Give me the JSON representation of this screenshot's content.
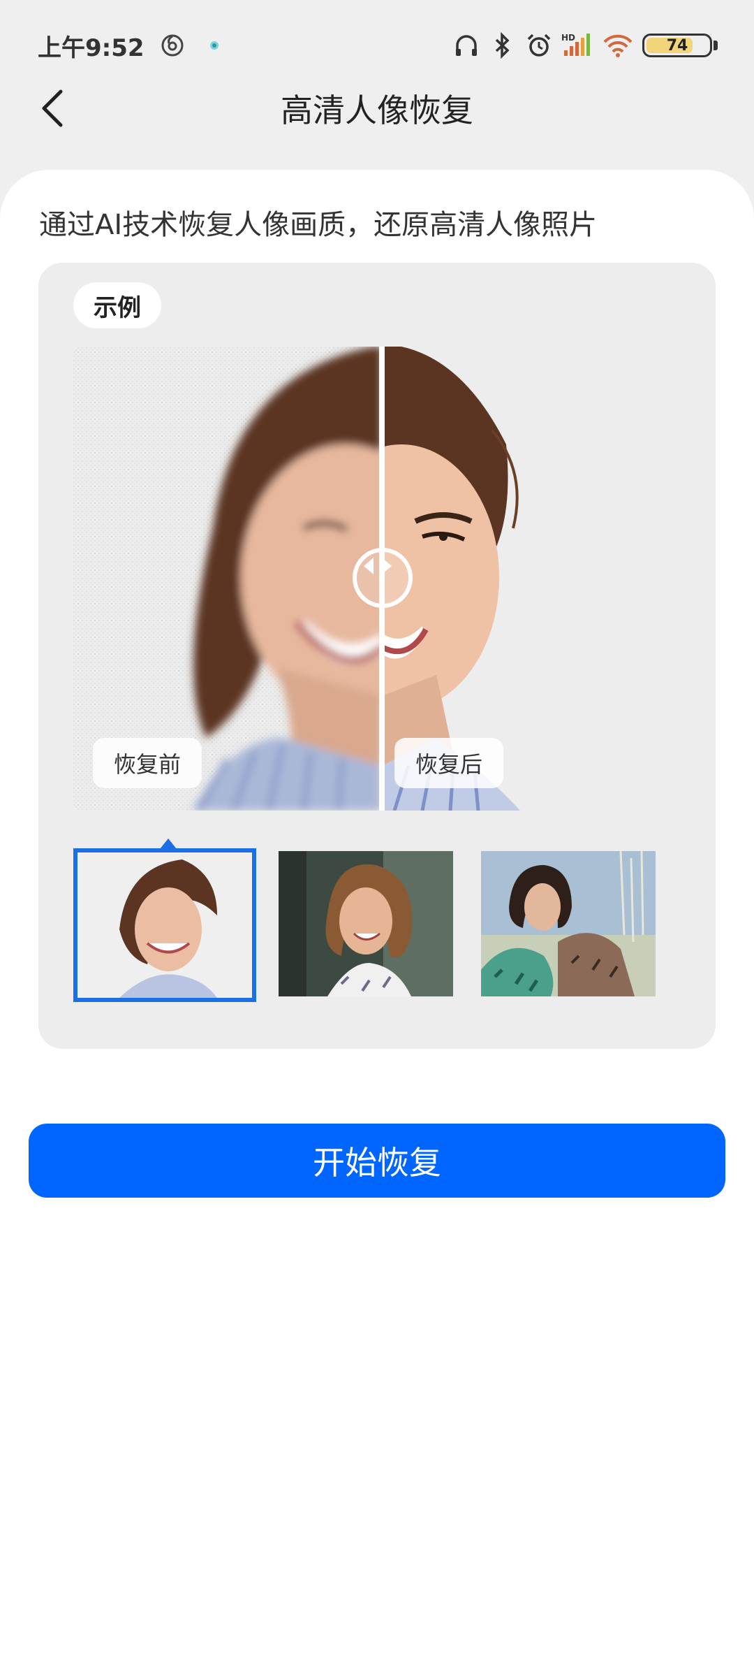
{
  "status_bar": {
    "time": "上午9:52",
    "battery_level": "74",
    "signal_label": "HD",
    "icons": [
      "netease-music-icon",
      "app-notification-icon",
      "headphones-icon",
      "bluetooth-icon",
      "alarm-icon",
      "cellular-signal-icon",
      "wifi-icon",
      "battery-icon"
    ]
  },
  "header": {
    "title": "高清人像恢复",
    "back_icon": "chevron-left-icon"
  },
  "main": {
    "description": "通过AI技术恢复人像画质，还原高清人像照片",
    "example": {
      "tag": "示例",
      "before_label": "恢复前",
      "after_label": "恢复后",
      "slider_position": 0.5,
      "thumbnails": [
        {
          "name": "portrait-1",
          "selected": true
        },
        {
          "name": "portrait-2",
          "selected": false
        },
        {
          "name": "portrait-3",
          "selected": false
        }
      ]
    },
    "start_button": "开始恢复"
  },
  "colors": {
    "accent": "#0066ff",
    "selected_border": "#1a6fe6",
    "panel_bg": "#ededed",
    "page_bg": "#efefef"
  }
}
